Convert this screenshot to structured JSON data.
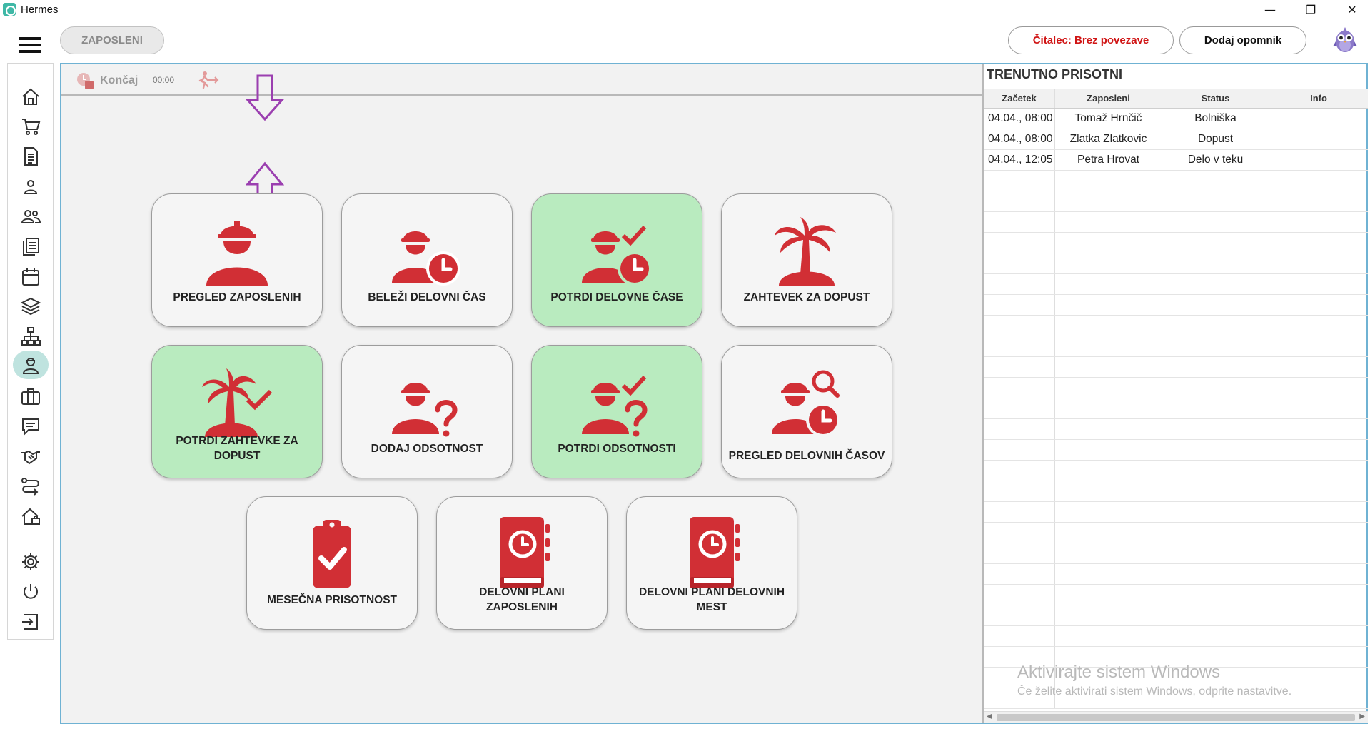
{
  "window": {
    "title": "Hermes",
    "min_glyph": "—",
    "max_glyph": "❐",
    "close_glyph": "✕"
  },
  "header": {
    "module_button": "ZAPOSLENI",
    "reader_button": "Čitalec: Brez povezave",
    "reminder_button": "Dodaj opomnik"
  },
  "toolbar": {
    "end_label": "Končaj",
    "timer": "00:00"
  },
  "sidebar": {
    "items": [
      "home-icon",
      "cart-icon",
      "document-icon",
      "person-icon",
      "people-icon",
      "copies-icon",
      "calendar-icon",
      "layers-icon",
      "sitemap-icon",
      "employee-icon",
      "briefcase-icon",
      "chat-icon",
      "handshake-icon",
      "routes-icon",
      "house-icon",
      "gear-icon",
      "power-icon",
      "logout-icon"
    ],
    "active": "employee-icon"
  },
  "tiles": [
    {
      "label": "PREGLED ZAPOSLENIH",
      "icon": "worker-icon",
      "green": false
    },
    {
      "label": "BELEŽI DELOVNI ČAS",
      "icon": "worker-clock-icon",
      "green": false
    },
    {
      "label": "POTRDI DELOVNE ČASE",
      "icon": "worker-clock-check-icon",
      "green": true
    },
    {
      "label": "ZAHTEVEK ZA DOPUST",
      "icon": "palm-island-icon",
      "green": false
    },
    {
      "label": "POTRDI ZAHTEVKE ZA DOPUST",
      "icon": "palm-island-check-icon",
      "green": true
    },
    {
      "label": "DODAJ ODSOTNOST",
      "icon": "worker-question-icon",
      "green": false
    },
    {
      "label": "POTRDI ODSOTNOSTI",
      "icon": "worker-question-check-icon",
      "green": true
    },
    {
      "label": "PREGLED DELOVNIH ČASOV",
      "icon": "worker-search-clock-icon",
      "green": false
    },
    {
      "label": "MESEČNA PRISOTNOST",
      "icon": "clipboard-check-icon",
      "green": false
    },
    {
      "label": "DELOVNI PLANI ZAPOSLENIH",
      "icon": "planner-clock-icon",
      "green": false
    },
    {
      "label": "DELOVNI PLANI DELOVNIH MEST",
      "icon": "planner-clock-icon",
      "green": false
    }
  ],
  "presence": {
    "title": "TRENUTNO PRISOTNI",
    "columns": [
      "Začetek",
      "Zaposleni",
      "Status",
      "Info"
    ],
    "rows": [
      [
        "04.04., 08:00",
        "Tomaž Hrnčič",
        "Bolniška",
        ""
      ],
      [
        "04.04., 08:00",
        "Zlatka Zlatkovic",
        "Dopust",
        ""
      ],
      [
        "04.04., 12:05",
        "Petra Hrovat",
        "Delo v teku",
        ""
      ]
    ]
  },
  "watermark": {
    "line1": "Aktivirajte sistem Windows",
    "line2": "Če želite aktivirati sistem Windows, odprite nastavitve."
  },
  "colors": {
    "accent_red": "#d12f35",
    "tile_green": "#b9ebbf",
    "active_sidebar": "#bfe3df",
    "panel_border": "#6fb2d3",
    "annotation_arrow": "#9b3fb0"
  }
}
